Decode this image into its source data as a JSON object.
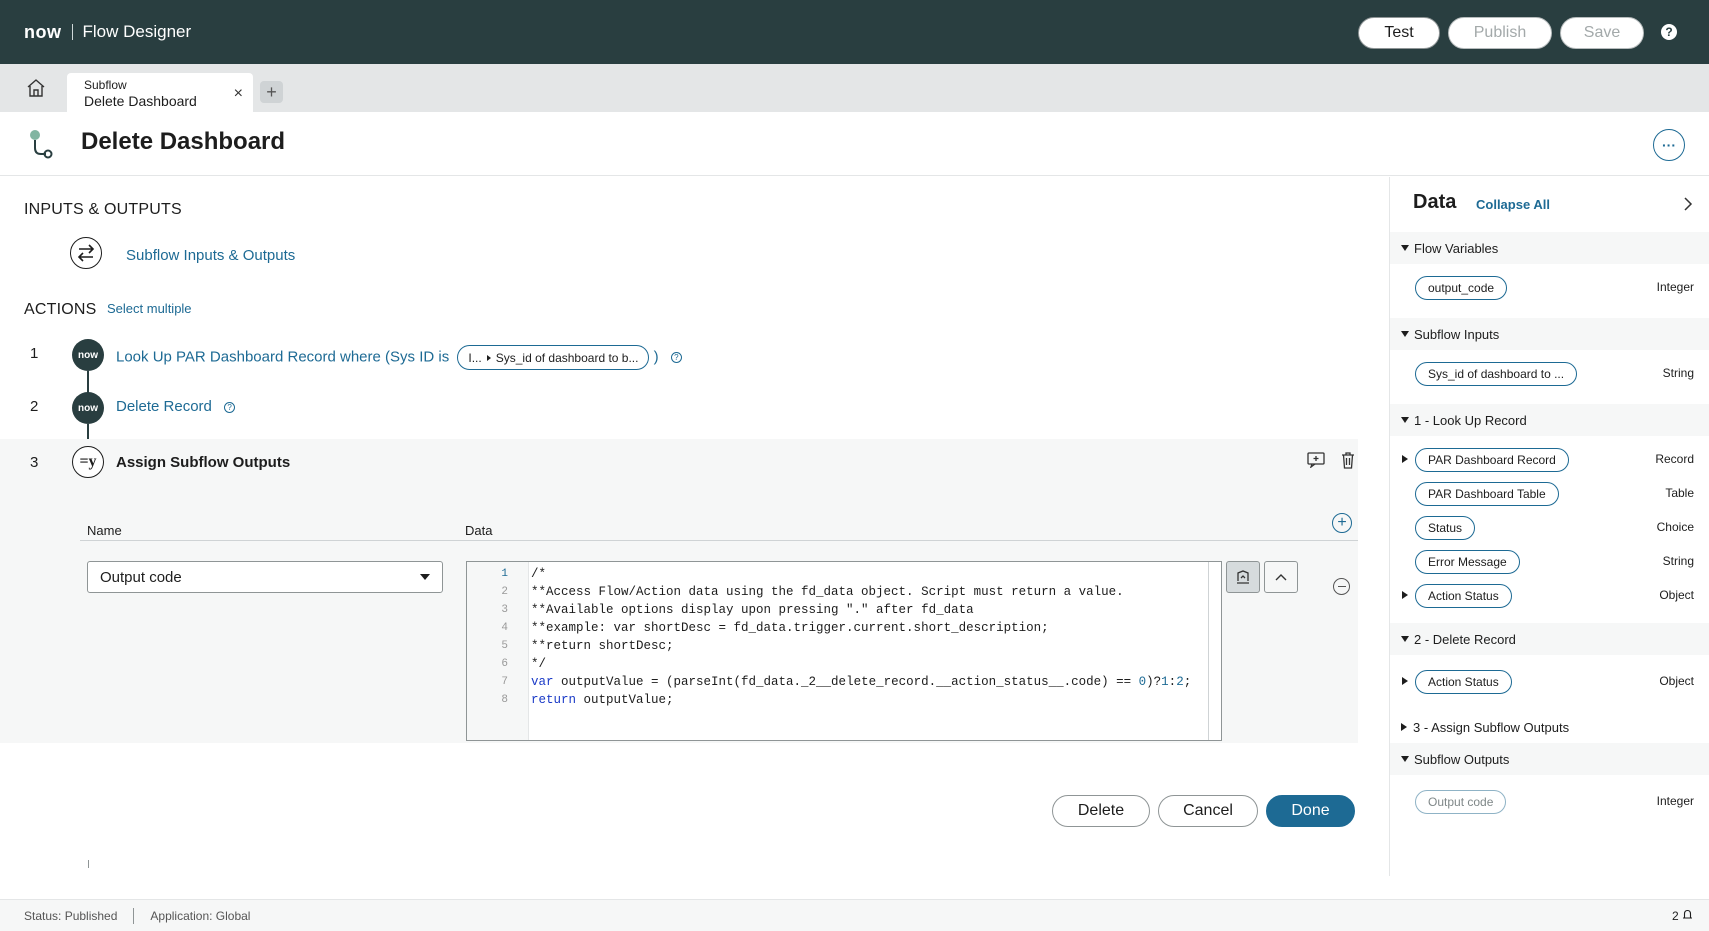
{
  "topbar": {
    "logo": "now",
    "app_title": "Flow Designer",
    "help": "?"
  },
  "tabs": {
    "kind": "Subflow",
    "name": "Delete Dashboard",
    "close": "×",
    "add": "+"
  },
  "header": {
    "title": "Delete Dashboard",
    "test_label": "Test",
    "publish_label": "Publish",
    "save_label": "Save",
    "more_label": "···"
  },
  "io": {
    "section_title": "INPUTS & OUTPUTS",
    "link_label": "Subflow Inputs & Outputs"
  },
  "actions": {
    "section_title": "ACTIONS",
    "select_multiple": "Select multiple",
    "steps": [
      {
        "num": "1",
        "icon": "now",
        "label": "Look Up PAR Dashboard Record where (Sys ID is",
        "pill_prefix": "I...",
        "pill_text": "Sys_id of dashboard to b...",
        "suffix": ")"
      },
      {
        "num": "2",
        "icon": "now",
        "label": "Delete Record"
      },
      {
        "num": "3",
        "icon": "=y",
        "label": "Assign Subflow Outputs"
      }
    ]
  },
  "assign": {
    "col_name": "Name",
    "col_data": "Data",
    "selected_name": "Output code",
    "code_lines": [
      {
        "n": "1",
        "text": "/*"
      },
      {
        "n": "2",
        "text": "**Access Flow/Action data using the fd_data object. Script must return a value."
      },
      {
        "n": "3",
        "text": "**Available options display upon pressing \".\" after fd_data"
      },
      {
        "n": "4",
        "text": "**example: var shortDesc = fd_data.trigger.current.short_description;"
      },
      {
        "n": "5",
        "text": "**return shortDesc;"
      },
      {
        "n": "6",
        "text": "*/"
      },
      {
        "n": "7",
        "text": "var outputValue = (parseInt(fd_data._2__delete_record.__action_status__.code) == 0)?1:2;"
      },
      {
        "n": "8",
        "text": "return outputValue;"
      }
    ],
    "delete_label": "Delete",
    "cancel_label": "Cancel",
    "done_label": "Done"
  },
  "data_panel": {
    "title": "Data",
    "collapse_all": "Collapse All",
    "groups": {
      "flow_variables": "Flow Variables",
      "subflow_inputs": "Subflow Inputs",
      "lookup": "1 - Look Up Record",
      "delete": "2 - Delete Record",
      "assign": "3 - Assign Subflow Outputs",
      "subflow_outputs": "Subflow Outputs"
    },
    "items": {
      "output_code": {
        "label": "output_code",
        "type": "Integer"
      },
      "sys_id": {
        "label": "Sys_id of dashboard to ...",
        "type": "String"
      },
      "par_record": {
        "label": "PAR Dashboard Record",
        "type": "Record"
      },
      "par_table": {
        "label": "PAR Dashboard Table",
        "type": "Table"
      },
      "status": {
        "label": "Status",
        "type": "Choice"
      },
      "error_message": {
        "label": "Error Message",
        "type": "String"
      },
      "action_status_1": {
        "label": "Action Status",
        "type": "Object"
      },
      "action_status_2": {
        "label": "Action Status",
        "type": "Object"
      },
      "out_code": {
        "label": "Output code",
        "type": "Integer"
      }
    }
  },
  "statusbar": {
    "status": "Status: Published",
    "application": "Application: Global",
    "right": "2"
  },
  "colors": {
    "topbar": "#293e40",
    "accent": "#1d6a94",
    "logo_o": "#81b5a1"
  }
}
